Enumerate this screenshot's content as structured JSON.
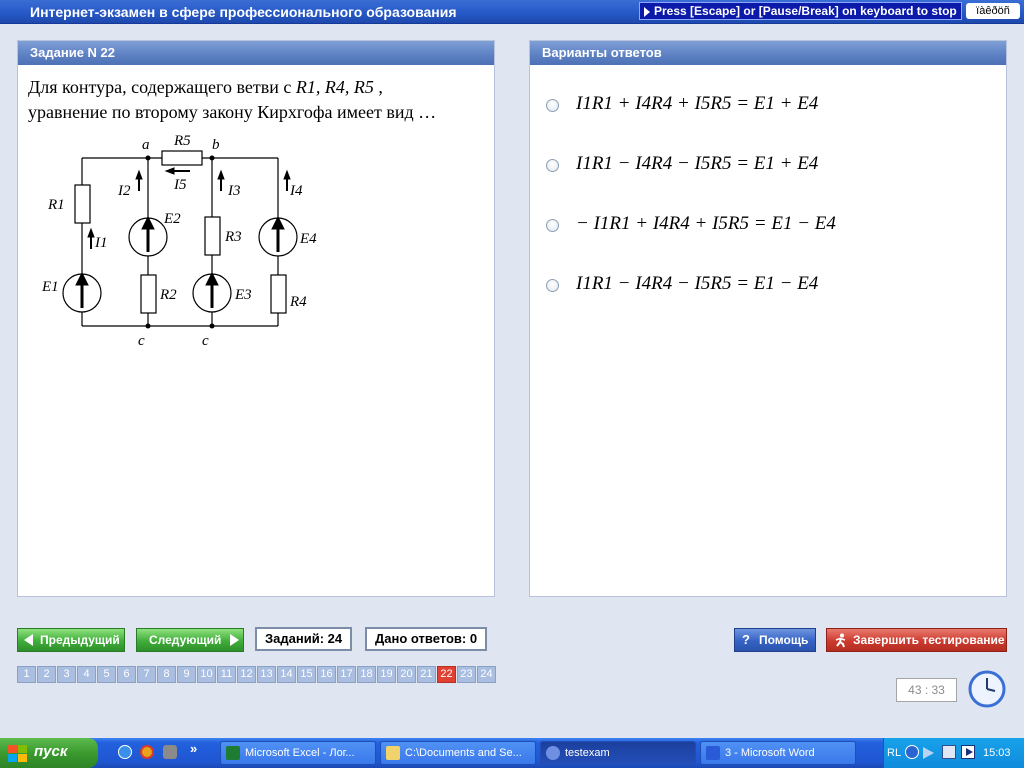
{
  "window": {
    "title": "Интернет-экзамен в сфере профессионального образования",
    "escape_hint": "Press [Escape] or [Pause/Break] on keyboard to stop",
    "lang_box": "ïàêðöñ"
  },
  "question": {
    "header": "Задание N 22",
    "text_a": "Для контура, содержащего ветви с ",
    "text_vars": "R1, R4, R5",
    "text_b": " ,",
    "text_c": "уравнение по второму закону Кирхгофа имеет вид …",
    "circuit": {
      "node_a": "a",
      "node_b": "b",
      "node_c1": "c",
      "node_c2": "c",
      "R1": "R1",
      "R2": "R2",
      "R3": "R3",
      "R4": "R4",
      "R5": "R5",
      "E1": "E1",
      "E2": "E2",
      "E3": "E3",
      "E4": "E4",
      "I1": "I1",
      "I2": "I2",
      "I3": "I3",
      "I4": "I4",
      "I5": "I5"
    }
  },
  "answers": {
    "header": "Варианты ответов",
    "options": [
      "I1R1 + I4R4 + I5R5 = E1 + E4",
      "I1R1 − I4R4 − I5R5 = E1 + E4",
      "− I1R1 + I4R4 + I5R5 = E1 − E4",
      "I1R1 − I4R4 − I5R5 = E1 − E4"
    ]
  },
  "nav": {
    "prev": "Предыдущий",
    "next": "Следующий",
    "total": "Заданий: 24",
    "answered": "Дано ответов: 0",
    "help": "Помощь",
    "finish": "Завершить тестирование",
    "timer": "43 : 33",
    "current_page": 22,
    "pages": [
      "1",
      "2",
      "3",
      "4",
      "5",
      "6",
      "7",
      "8",
      "9",
      "10",
      "11",
      "12",
      "13",
      "14",
      "15",
      "16",
      "17",
      "18",
      "19",
      "20",
      "21",
      "22",
      "23",
      "24"
    ]
  },
  "taskbar": {
    "start": "пуск",
    "tasks": [
      "Microsoft Excel - Лог...",
      "C:\\Documents and Se...",
      "testexam",
      "3 - Microsoft Word"
    ],
    "lang": "RL",
    "clock": "15:03"
  },
  "colors": {
    "accent": "#2557c6",
    "active_page": "#e04133",
    "green_button": "#3fae3a",
    "finish_button": "#cc3b2e"
  }
}
